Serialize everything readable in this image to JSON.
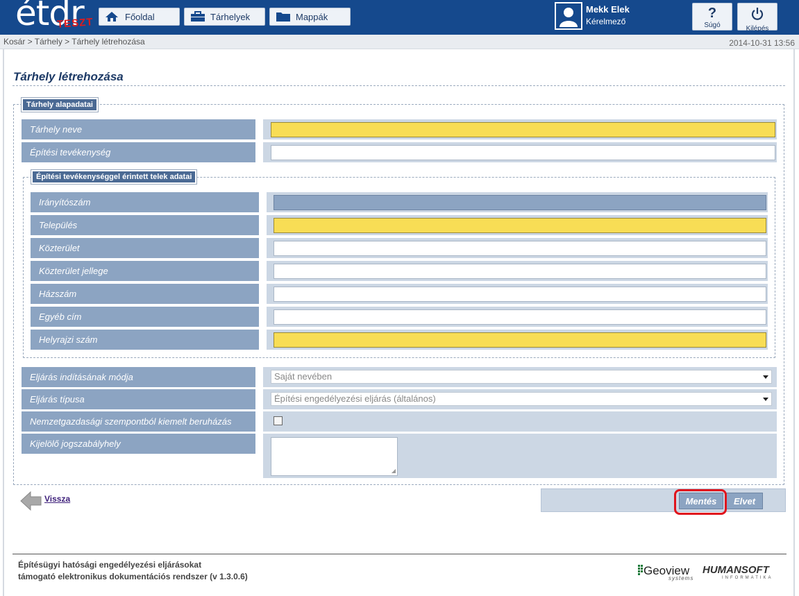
{
  "header": {
    "logo_text": "étdr",
    "logo_badge": "TESZT",
    "nav": [
      {
        "label": "Főoldal",
        "icon": "home-icon"
      },
      {
        "label": "Tárhelyek",
        "icon": "briefcase-icon"
      },
      {
        "label": "Mappák",
        "icon": "folder-icon"
      }
    ],
    "user": {
      "name": "Mekk Elek",
      "role": "Kérelmező"
    },
    "help_label": "Súgó",
    "logout_label": "Kilépés"
  },
  "breadcrumb": "Kosár > Tárhely > Tárhely létrehozása",
  "datetime": "2014-10-31 13:56",
  "page_title": "Tárhely létrehozása",
  "basic_section": {
    "legend": "Tárhely alapadatai",
    "fields": [
      {
        "label": "Tárhely neve",
        "value": "",
        "required": true
      },
      {
        "label": "Építési tevékenység",
        "value": "",
        "required": false
      }
    ]
  },
  "parcel_section": {
    "legend": "Építési tevékenységgel érintett telek adatai",
    "fields": [
      {
        "label": "Irányítószám",
        "value": "",
        "state": "disabled"
      },
      {
        "label": "Település",
        "value": "",
        "state": "required"
      },
      {
        "label": "Közterület",
        "value": "",
        "state": "normal"
      },
      {
        "label": "Közterület jellege",
        "value": "",
        "state": "normal"
      },
      {
        "label": "Házszám",
        "value": "",
        "state": "normal"
      },
      {
        "label": "Egyéb cím",
        "value": "",
        "state": "normal"
      },
      {
        "label": "Helyrajzi szám",
        "value": "",
        "state": "required"
      }
    ]
  },
  "procedure": {
    "start_mode": {
      "label": "Eljárás indításának módja",
      "selected": "Saját nevében"
    },
    "type": {
      "label": "Eljárás típusa",
      "selected": "Építési engedélyezési eljárás (általános)"
    },
    "priority_investment": {
      "label": "Nemzetgazdasági szempontból kiemelt beruházás",
      "checked": false
    },
    "legal_reference": {
      "label": "Kijelölő jogszabályhely",
      "value": ""
    }
  },
  "back_label": "Vissza",
  "actions": {
    "save_label": "Mentés",
    "discard_label": "Elvet"
  },
  "footer": {
    "line1": "Építésügyi hatósági engedélyezési eljárásokat",
    "line2": "támogató elektronikus dokumentációs rendszer (v 1.3.0.6)",
    "geoview": "Geoview",
    "geoview_sub": "systems",
    "humansoft": "HUMANSOFT",
    "humansoft_sub": "INFORMATIKA"
  },
  "colors": {
    "header_bg": "#15498d",
    "label_bg": "#8ca4c2",
    "required_input": "#f8dd55",
    "highlight": "#e0141c"
  }
}
